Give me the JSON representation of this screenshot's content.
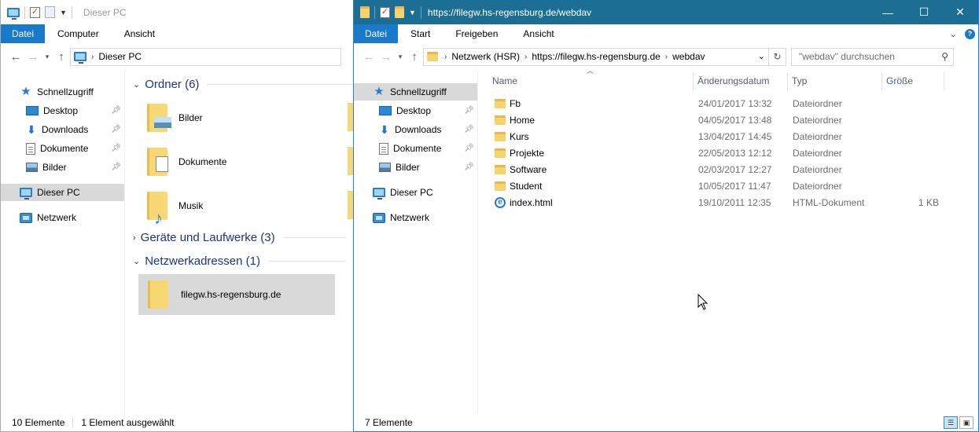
{
  "left": {
    "title": "Dieser PC",
    "tabs": [
      "Datei",
      "Computer",
      "Ansicht"
    ],
    "address": "Dieser PC",
    "nav": {
      "quick_access": "Schnellzugriff",
      "desktop": "Desktop",
      "downloads": "Downloads",
      "documents": "Dokumente",
      "pictures": "Bilder",
      "this_pc": "Dieser PC",
      "network": "Netzwerk"
    },
    "groups": {
      "folders": "Ordner (6)",
      "devices": "Geräte und Laufwerke (3)",
      "netlocs": "Netzwerkadressen (1)"
    },
    "folders": [
      "Bilder",
      "Dokumente",
      "Musik"
    ],
    "network_location": "filegw.hs-regensburg.de",
    "status": {
      "count": "10 Elemente",
      "selected": "1 Element ausgewählt"
    }
  },
  "right": {
    "title": "https://filegw.hs-regensburg.de/webdav",
    "tabs": [
      "Datei",
      "Start",
      "Freigeben",
      "Ansicht"
    ],
    "breadcrumbs": [
      "Netzwerk (HSR)",
      "https://filegw.hs-regensburg.de",
      "webdav"
    ],
    "search_placeholder": "\"webdav\" durchsuchen",
    "nav": {
      "quick_access": "Schnellzugriff",
      "desktop": "Desktop",
      "downloads": "Downloads",
      "documents": "Dokumente",
      "pictures": "Bilder",
      "this_pc": "Dieser PC",
      "network": "Netzwerk"
    },
    "columns": {
      "name": "Name",
      "date": "Änderungsdatum",
      "type": "Typ",
      "size": "Größe"
    },
    "files": [
      {
        "name": "Fb",
        "date": "24/01/2017 13:32",
        "type": "Dateiordner",
        "size": "",
        "icon": "folder-icon"
      },
      {
        "name": "Home",
        "date": "04/05/2017 13:48",
        "type": "Dateiordner",
        "size": "",
        "icon": "folder-icon"
      },
      {
        "name": "Kurs",
        "date": "13/04/2017 14:45",
        "type": "Dateiordner",
        "size": "",
        "icon": "folder-icon"
      },
      {
        "name": "Projekte",
        "date": "22/05/2013 12:12",
        "type": "Dateiordner",
        "size": "",
        "icon": "folder-icon"
      },
      {
        "name": "Software",
        "date": "02/03/2017 12:27",
        "type": "Dateiordner",
        "size": "",
        "icon": "folder-icon"
      },
      {
        "name": "Student",
        "date": "10/05/2017 11:47",
        "type": "Dateiordner",
        "size": "",
        "icon": "folder-icon"
      },
      {
        "name": "index.html",
        "date": "19/10/2011 12:35",
        "type": "HTML-Dokument",
        "size": "1 KB",
        "icon": "ie-html-icon"
      }
    ],
    "status": {
      "count": "7 Elemente"
    }
  },
  "colors": {
    "accent": "#1979ca",
    "titlebar_active": "#1d6e94",
    "group_heading": "#1e3287"
  }
}
